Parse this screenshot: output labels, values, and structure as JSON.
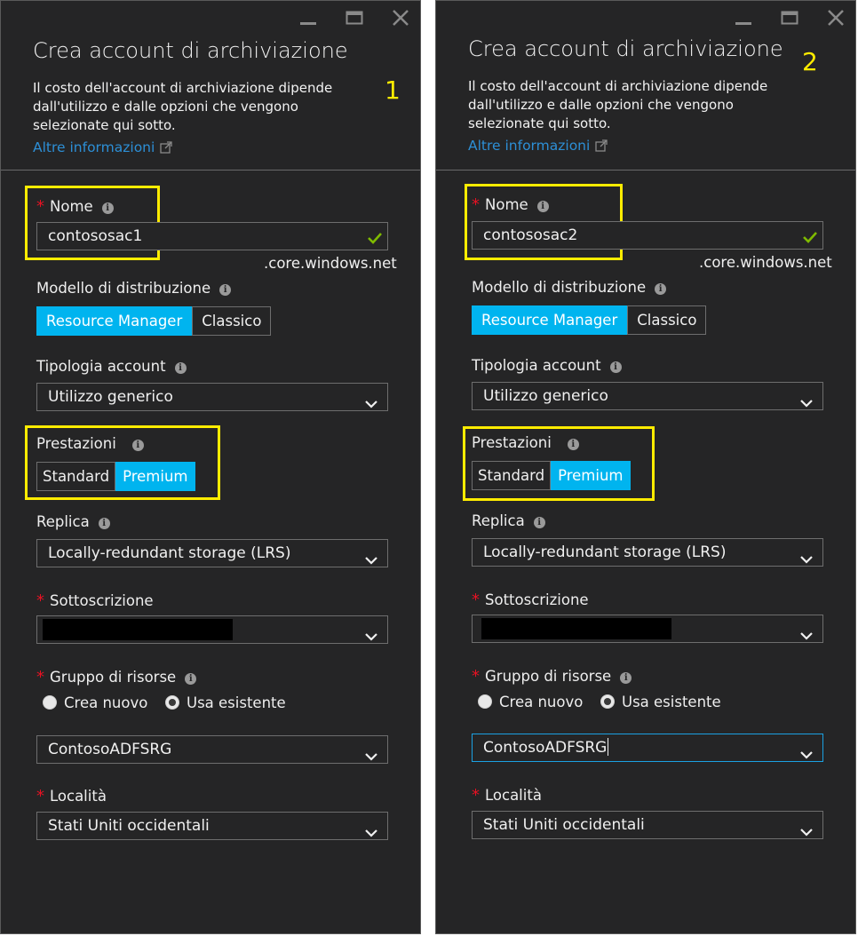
{
  "blade_title": "Crea account di archiviazione",
  "description": "Il costo dell'account di archiviazione dipende dall'utilizzo e dalle opzioni che vengono selezionate qui sotto.",
  "more_info": "Altre informazioni",
  "required_mark": "*",
  "info_glyph": "i",
  "name_label": "Nome",
  "name_suffix": ".core.windows.net",
  "deployment_label": "Modello di distribuzione",
  "deployment_options": [
    "Resource Manager",
    "Classico"
  ],
  "account_kind_label": "Tipologia account",
  "account_kind_value": "Utilizzo generico",
  "performance_label": "Prestazioni",
  "performance_options": [
    "Standard",
    "Premium"
  ],
  "replication_label": "Replica",
  "replication_value": "Locally-redundant storage (LRS)",
  "subscription_label": "Sottoscrizione",
  "resource_group_label": "Gruppo di risorse",
  "rg_option_new": "Crea nuovo",
  "rg_option_existing": "Usa esistente",
  "resource_group_value": "ContosoADFSRG",
  "location_label": "Località",
  "location_value": "Stati Uniti occidentali",
  "blades": [
    {
      "step": "1",
      "name_value": "contososac1",
      "deployment_selected": "Resource Manager",
      "performance_selected": "Premium",
      "rg_selected": "Usa esistente",
      "rg_focused": false
    },
    {
      "step": "2",
      "name_value": "contososac2",
      "deployment_selected": "Resource Manager",
      "performance_selected": "Premium",
      "rg_selected": "Usa esistente",
      "rg_focused": true
    }
  ],
  "colors": {
    "panel": "#252526",
    "accent": "#00b4ef",
    "highlight": "#ffec00",
    "link": "#2d8fd6",
    "required": "#e81123",
    "valid": "#7fba00",
    "focus": "#1ba1e2"
  },
  "icons": [
    "minimize-icon",
    "maximize-icon",
    "close-icon",
    "external-link-icon",
    "info-icon",
    "check-icon",
    "chevron-down-icon",
    "radio-icon"
  ]
}
